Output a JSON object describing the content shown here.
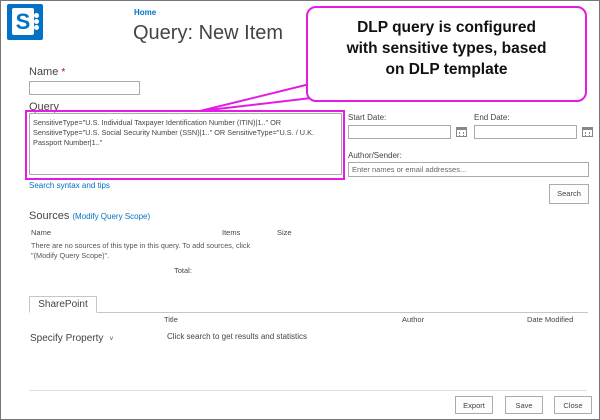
{
  "header": {
    "home_link": "Home",
    "page_title": "Query: New Item"
  },
  "form": {
    "name_label": "Name",
    "required_marker": "*",
    "query_label": "Query",
    "query_lines": [
      "SensitiveType=\"U.S. Individual Taxpayer Identification Number (ITIN)|1..\" OR",
      "SensitiveType=\"U.S. Social Security Number (SSN)|1..\" OR SensitiveType=\"U.S. / U.K.",
      "Passport Number|1..\""
    ],
    "search_syntax_link": "Search syntax and tips",
    "start_date_label": "Start Date:",
    "end_date_label": "End Date:",
    "author_label": "Author/Sender:",
    "author_placeholder": "Enter names or email addresses...",
    "search_button": "Search"
  },
  "sources": {
    "title": "Sources",
    "modify_link": "(Modify Query Scope)",
    "columns": [
      "Name",
      "Items",
      "Size"
    ],
    "empty_note_line1": "There are no sources of this type in this query. To add sources, click",
    "empty_note_line2": "\"(Modify Query Scope)\".",
    "total_label": "Total:"
  },
  "results": {
    "tab_label": "SharePoint",
    "columns": [
      "Title",
      "Author",
      "Date Modified"
    ],
    "specify_property": "Specify Property",
    "chevron": "˅",
    "click_message": "Click search to get results and statistics"
  },
  "footer": {
    "export_button": "Export",
    "save_button": "Save",
    "close_button": "Close"
  },
  "callout": {
    "lines": [
      "DLP query is configured",
      "with sensitive types, based",
      "on DLP template"
    ]
  },
  "colors": {
    "brand": "#0372c6",
    "link": "#0072c6",
    "highlight": "#e31ce3",
    "required": "#bf0000"
  }
}
